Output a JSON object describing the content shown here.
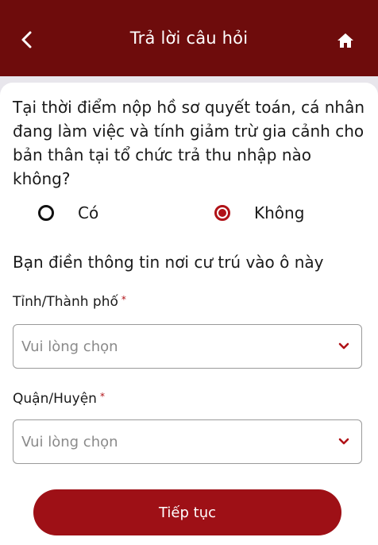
{
  "header": {
    "title": "Trả lời câu hỏi",
    "back_icon": "chevron-left-icon",
    "home_icon": "home-icon",
    "background_color": "#6e0c0c"
  },
  "question": {
    "text": "Tại thời điểm nộp hồ sơ quyết toán, cá nhân đang làm việc và tính giảm trừ gia cảnh cho bản thân tại tổ chức trả thu nhập nào không?",
    "options": [
      {
        "label": "Có",
        "selected": false
      },
      {
        "label": "Không",
        "selected": true
      }
    ]
  },
  "residence": {
    "instruction": "Bạn điền thông tin nơi cư trú vào ô này",
    "province": {
      "label": "Tỉnh/Thành phố",
      "required_mark": "*",
      "placeholder": "Vui lòng chọn"
    },
    "district": {
      "label": "Quận/Huyện",
      "required_mark": "*",
      "placeholder": "Vui lòng chọn"
    }
  },
  "actions": {
    "continue_label": "Tiếp tục",
    "accent_color": "#9e1016"
  }
}
